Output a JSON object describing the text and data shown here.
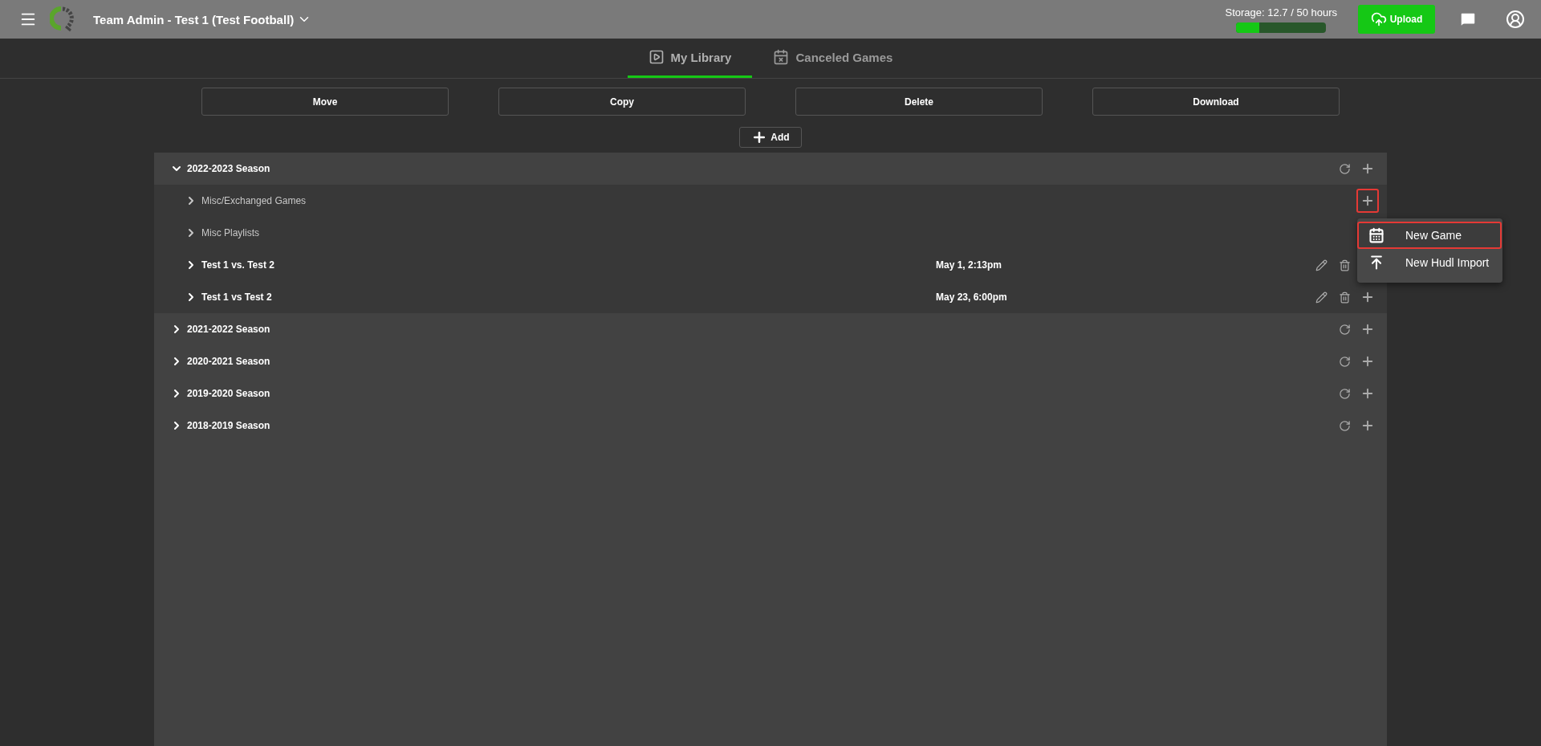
{
  "header": {
    "title": "Team Admin - Test 1 (Test Football)",
    "storage": {
      "label": "Storage: 12.7 / 50 hours",
      "level": 0.254
    },
    "upload_button": "Upload"
  },
  "tabs": [
    {
      "label": "My Library",
      "selected": true
    },
    {
      "label": "Canceled Games",
      "selected": false
    }
  ],
  "toolbar": [
    "Move",
    "Copy",
    "Delete",
    "Download"
  ],
  "add_button": "Add",
  "seasons": [
    {
      "label": "2022-2023 Season",
      "expanded": true,
      "children": [
        {
          "kind": "folder",
          "label": "Misc/Exchanged Games",
          "add_highlighted": true
        },
        {
          "kind": "folder",
          "label": "Misc Playlists"
        },
        {
          "kind": "game",
          "label": "Test 1 vs. Test 2",
          "date": "May 1, 2:13pm"
        },
        {
          "kind": "game",
          "label": "Test 1 vs Test 2",
          "date": "May 23, 6:00pm"
        }
      ]
    },
    {
      "label": "2021-2022 Season",
      "expanded": false
    },
    {
      "label": "2020-2021 Season",
      "expanded": false
    },
    {
      "label": "2019-2020 Season",
      "expanded": false
    },
    {
      "label": "2018-2019 Season",
      "expanded": false
    }
  ],
  "menu": [
    {
      "label": "New Game",
      "highlighted": true
    },
    {
      "label": "New Hudl Import",
      "highlighted": false
    }
  ]
}
